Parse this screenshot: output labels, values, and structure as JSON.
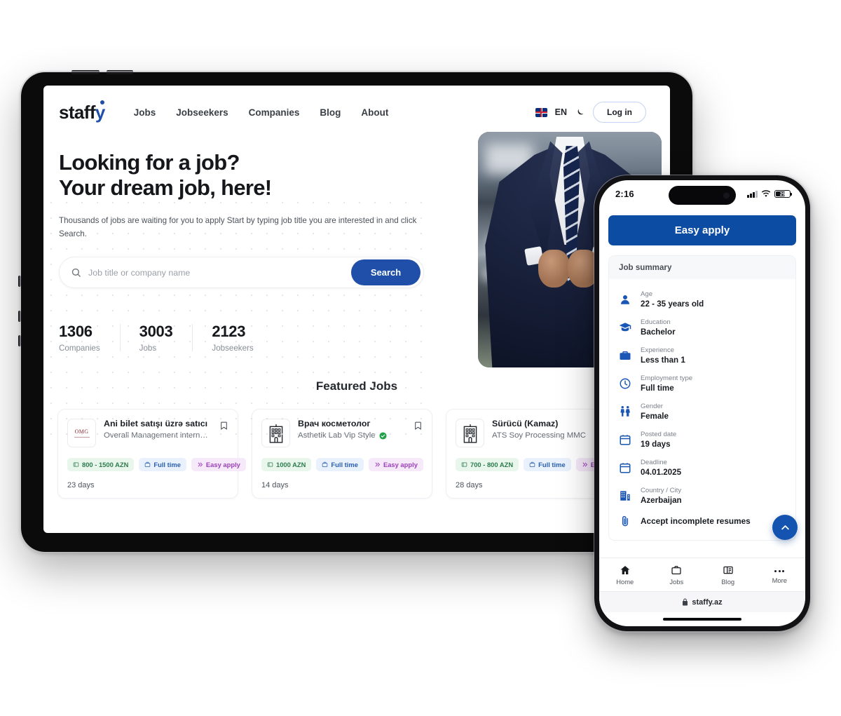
{
  "tablet": {
    "header": {
      "logo_text": "staff",
      "logo_accent": "y",
      "nav": [
        {
          "label": "Jobs"
        },
        {
          "label": "Jobseekers"
        },
        {
          "label": "Companies"
        },
        {
          "label": "Blog"
        },
        {
          "label": "About"
        }
      ],
      "language": "EN",
      "flag_icon": "uk-flag-icon",
      "theme_icon": "moon-icon",
      "login_label": "Log in"
    },
    "hero": {
      "title_line1": "Looking for a job?",
      "title_line2": "Your dream job, here!",
      "subtitle": "Thousands of jobs are waiting for you to apply Start by typing job title you are interested in and click Search.",
      "search_placeholder": "Job title or company name",
      "search_value": "",
      "search_button": "Search",
      "search_icon": "search-icon",
      "photo_alt": "businessman-in-navy-suit",
      "stats": [
        {
          "value": "1306",
          "label": "Companies"
        },
        {
          "value": "3003",
          "label": "Jobs"
        },
        {
          "value": "2123",
          "label": "Jobseekers"
        }
      ]
    },
    "featured": {
      "title": "Featured Jobs",
      "cards": [
        {
          "logo_type": "omg-logo",
          "logo_text": "OMG",
          "title": "Ani bilet satışı üzrə satıcı",
          "company": "Overall Management international...",
          "verified": false,
          "salary": "800 - 1500 AZN",
          "employment": "Full time",
          "apply": "Easy apply",
          "days": "23 days"
        },
        {
          "logo_type": "building-icon",
          "logo_text": "",
          "title": "Врач косметолог",
          "company": "Asthetik Lab Vip Style",
          "verified": true,
          "salary": "1000 AZN",
          "employment": "Full time",
          "apply": "Easy apply",
          "days": "14 days"
        },
        {
          "logo_type": "building-icon",
          "logo_text": "",
          "title": "Sürücü (Kamaz)",
          "company": "ATS Soy Processing MMC",
          "verified": false,
          "salary": "700 - 800 AZN",
          "employment": "Full time",
          "apply": "Easy apply",
          "days": "28 days"
        }
      ]
    }
  },
  "phone": {
    "status": {
      "time": "2:16",
      "battery": "29",
      "signal_icon": "cellular-bars-icon",
      "wifi_icon": "wifi-icon"
    },
    "apply_button": "Easy apply",
    "summary_title": "Job summary",
    "summary_rows": [
      {
        "icon": "person-icon",
        "label": "Age",
        "value": "22 - 35 years old"
      },
      {
        "icon": "graduation-icon",
        "label": "Education",
        "value": "Bachelor"
      },
      {
        "icon": "briefcase-icon",
        "label": "Experience",
        "value": "Less than 1"
      },
      {
        "icon": "clock-icon",
        "label": "Employment type",
        "value": "Full time"
      },
      {
        "icon": "gender-icon",
        "label": "Gender",
        "value": "Female"
      },
      {
        "icon": "calendar-icon",
        "label": "Posted date",
        "value": "19 days"
      },
      {
        "icon": "calendar-icon",
        "label": "Deadline",
        "value": "04.01.2025"
      },
      {
        "icon": "building-icon",
        "label": "Country / City",
        "value": "Azerbaijan"
      }
    ],
    "resume_note": "Accept incomplete resumes",
    "resume_icon": "paperclip-icon",
    "scroll_top_icon": "chevron-up-icon",
    "tabs": [
      {
        "icon": "home-icon",
        "label": "Home"
      },
      {
        "icon": "briefcase-icon",
        "label": "Jobs"
      },
      {
        "icon": "blog-icon",
        "label": "Blog"
      },
      {
        "icon": "more-icon",
        "label": "More"
      }
    ],
    "url": "staffy.az",
    "lock_icon": "lock-icon"
  },
  "colors": {
    "primary_blue": "#1f4fa8",
    "apply_blue": "#0c4ca3",
    "salary_green": "#2e7d4f",
    "apply_purple": "#9c3fbb"
  }
}
